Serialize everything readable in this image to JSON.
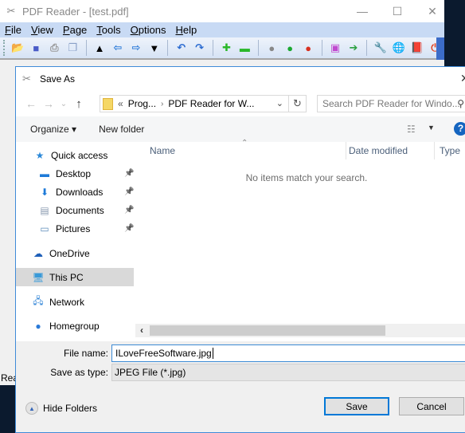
{
  "app": {
    "title": "PDF Reader - [test.pdf]",
    "window_controls": {
      "minimize": "—",
      "maximize": "☐",
      "close": "✕"
    },
    "menu": [
      {
        "label": "File",
        "accel": "F",
        "rest": "ile"
      },
      {
        "label": "View",
        "accel": "V",
        "rest": "iew"
      },
      {
        "label": "Page",
        "accel": "P",
        "rest": "age"
      },
      {
        "label": "Tools",
        "accel": "T",
        "rest": "ools"
      },
      {
        "label": "Options",
        "accel": "O",
        "rest": "ptions"
      },
      {
        "label": "Help",
        "accel": "H",
        "rest": "elp"
      }
    ],
    "toolbar": [
      {
        "name": "open-icon",
        "glyph": "📂",
        "color": "#e8a020"
      },
      {
        "name": "save-icon",
        "glyph": "■",
        "color": "#4a5cc8"
      },
      {
        "name": "print-icon",
        "glyph": "⎙",
        "color": "#999999"
      },
      {
        "name": "copy-icon",
        "glyph": "❐",
        "color": "#8aa0c8"
      },
      {
        "sep": true
      },
      {
        "name": "first-page-icon",
        "glyph": "▲",
        "color": "#000000"
      },
      {
        "name": "previous-page-icon",
        "glyph": "⇦",
        "color": "#2a7ad8"
      },
      {
        "name": "next-page-icon",
        "glyph": "⇨",
        "color": "#2a7ad8"
      },
      {
        "name": "last-page-icon",
        "glyph": "▼",
        "color": "#000000"
      },
      {
        "sep": true
      },
      {
        "name": "undo-icon",
        "glyph": "↶",
        "color": "#2a6ad0"
      },
      {
        "name": "redo-icon",
        "glyph": "↷",
        "color": "#2a6ad0"
      },
      {
        "sep": true
      },
      {
        "name": "zoom-in-icon",
        "glyph": "✚",
        "color": "#2ab82a"
      },
      {
        "name": "zoom-out-icon",
        "glyph": "▬",
        "color": "#2ab82a"
      },
      {
        "sep": true
      },
      {
        "name": "gray-light-icon",
        "glyph": "●",
        "color": "#888888"
      },
      {
        "name": "green-light-icon",
        "glyph": "●",
        "color": "#1aa830"
      },
      {
        "name": "red-light-icon",
        "glyph": "●",
        "color": "#d83020"
      },
      {
        "sep": true
      },
      {
        "name": "frame-icon",
        "glyph": "▣",
        "color": "#c04ad0"
      },
      {
        "name": "go-arrow-icon",
        "glyph": "➔",
        "color": "#2aa040"
      },
      {
        "sep": true
      },
      {
        "name": "wrench-icon",
        "glyph": "🔧",
        "color": "#b0b0b0"
      },
      {
        "name": "globe-icon",
        "glyph": "🌐",
        "color": "#e8b020"
      },
      {
        "name": "book-icon",
        "glyph": "📕",
        "color": "#8a2a8a"
      },
      {
        "name": "power-icon",
        "glyph": "⏻",
        "color": "#e04020"
      }
    ],
    "status_text": "Rea"
  },
  "dialog": {
    "title": "Save As",
    "close": "✕",
    "nav": {
      "back": "←",
      "forward": "→",
      "recent": "⌄",
      "up": "↑"
    },
    "address": {
      "prefix": "«",
      "crumbs": [
        "Prog...",
        "PDF Reader for W..."
      ]
    },
    "search_placeholder": "Search PDF Reader for Windo...",
    "organize_label": "Organize ▾",
    "new_folder_label": "New folder",
    "help": "?",
    "nav_pane": [
      {
        "label": "Quick access",
        "icon": "★",
        "icon_name": "star-icon",
        "color": "#2b88d8",
        "pinned": false
      },
      {
        "label": "Desktop",
        "icon": "▬",
        "icon_name": "desktop-icon",
        "color": "#1e7ad8",
        "pinned": true
      },
      {
        "label": "Downloads",
        "icon": "⬇",
        "icon_name": "download-icon",
        "color": "#1e7ad8",
        "pinned": true
      },
      {
        "label": "Documents",
        "icon": "▤",
        "icon_name": "document-icon",
        "color": "#8a9ab0",
        "pinned": true
      },
      {
        "label": "Pictures",
        "icon": "▭",
        "icon_name": "pictures-icon",
        "color": "#5a8ab8",
        "pinned": true
      },
      {
        "label": "OneDrive",
        "icon": "☁",
        "icon_name": "cloud-icon",
        "color": "#1e5fb8",
        "pinned": false
      },
      {
        "label": "This PC",
        "icon": "🖥",
        "icon_name": "computer-icon",
        "color": "#3a9ad8",
        "pinned": false,
        "selected": true
      },
      {
        "label": "Network",
        "icon": "🖧",
        "icon_name": "network-icon",
        "color": "#3a8ad8",
        "pinned": false
      },
      {
        "label": "Homegroup",
        "icon": "●",
        "icon_name": "homegroup-icon",
        "color": "#2a7ad8",
        "pinned": false
      }
    ],
    "pin_glyph": "📌",
    "columns": [
      "Name",
      "Date modified",
      "Type"
    ],
    "empty_message": "No items match your search.",
    "file_name_label": "File name:",
    "file_name_value": "ILoveFreeSoftware.jpg",
    "save_type_label": "Save as type:",
    "save_type_value": "JPEG File (*.jpg)",
    "hide_folders_label": "Hide Folders",
    "save_label": "Save",
    "cancel_label": "Cancel"
  }
}
